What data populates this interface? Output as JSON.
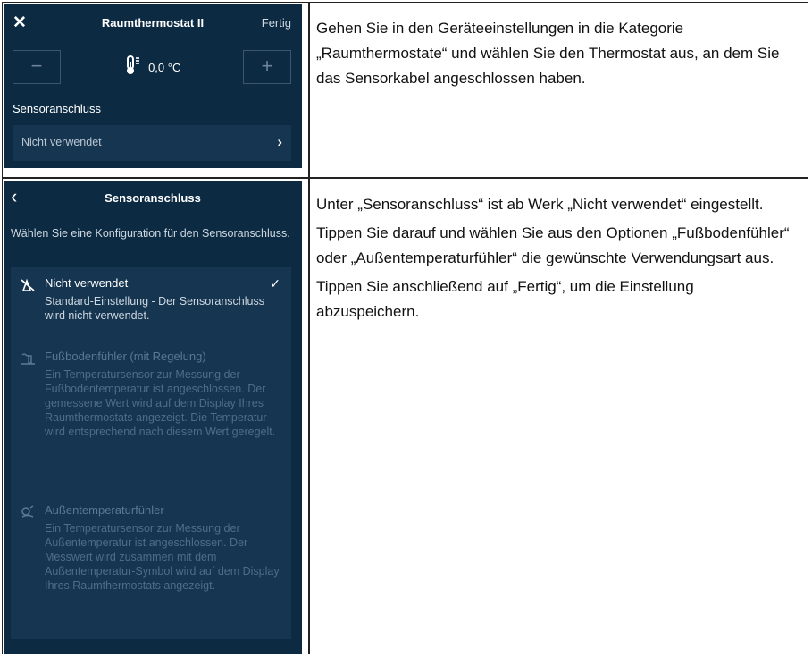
{
  "phone1": {
    "close_icon": "close-icon",
    "title": "Raumthermostat II",
    "done_label": "Fertig",
    "minus_label": "−",
    "plus_label": "+",
    "temperature": "0,0 °C",
    "section_label": "Sensoranschluss",
    "row_value": "Nicht verwendet",
    "row_chevron": "›"
  },
  "phone2": {
    "back_label": "‹",
    "title": "Sensoranschluss",
    "intro": "Wählen Sie eine Konfiguration für den Sensoranschluss.",
    "options": [
      {
        "title": "Nicht verwendet",
        "desc": "Standard-Einstellung - Der Sensoranschluss wird nicht verwendet.",
        "selected": true,
        "icon": "not-used-icon"
      },
      {
        "title": "Fußbodenfühler (mit Regelung)",
        "desc": "Ein Temperatursensor zur Messung der Fußbodentemperatur ist angeschlossen. Der gemessene Wert wird auf dem Display Ihres Raumthermostats angezeigt. Die Temperatur wird entsprechend nach diesem Wert geregelt.",
        "selected": false,
        "icon": "floor-sensor-icon"
      },
      {
        "title": "Außentemperaturfühler",
        "desc": "Ein Temperatursensor zur Messung der Außentemperatur ist angeschlossen. Der Messwert wird zusammen mit dem Außentemperatur-Symbol wird auf dem Display Ihres Raumthermostats angezeigt.",
        "selected": false,
        "icon": "outdoor-sensor-icon"
      }
    ],
    "check_mark": "✓"
  },
  "instructions": {
    "step1": "Gehen Sie in den Geräteeinstellungen in die Kategorie „Raumthermostate“ und wählen Sie den Thermostat aus, an dem Sie das Sensorkabel angeschlossen haben.",
    "step2_p1": "Unter „Sensoranschluss“ ist ab Werk „Nicht verwendet“ eingestellt.",
    "step2_p2": "Tippen Sie darauf und wählen Sie aus den Optionen „Fußbodenfühler“ oder „Außentemperaturfühler“ die gewünschte Verwendungsart aus.",
    "step2_p3": "Tippen Sie anschließend auf „Fertig“, um die Einstellung abzuspeichern."
  },
  "colors": {
    "app_background": "#0c2a42",
    "list_background": "#163550",
    "text_primary": "#ffffff",
    "text_dim": "#5a7891"
  }
}
